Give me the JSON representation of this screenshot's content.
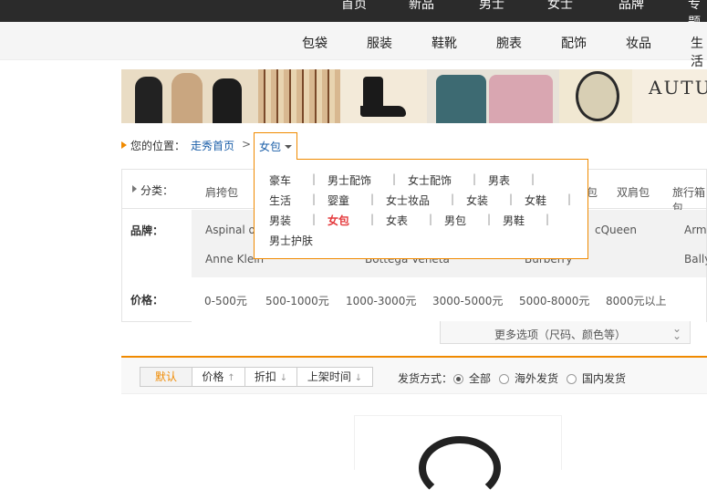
{
  "top_nav": [
    "首页",
    "新品",
    "男士",
    "女士",
    "品牌",
    "专题"
  ],
  "category_nav": [
    "包袋",
    "服装",
    "鞋靴",
    "腕表",
    "配饰",
    "妆品",
    "生活"
  ],
  "banner": {
    "text": "AUTUM"
  },
  "breadcrumb": {
    "label": "您的位置：",
    "home": "走秀首页",
    "separator": ">",
    "current": "女包"
  },
  "dropdown": {
    "items": [
      "豪车",
      "男士配饰",
      "女士配饰",
      "男表",
      "生活",
      "婴童",
      "女士妆品",
      "女装",
      "女鞋",
      "男装",
      "女包",
      "女表",
      "男包",
      "男鞋",
      "男士护肤"
    ],
    "active": "女包"
  },
  "filters": {
    "category_label": "分类：",
    "categories": [
      "肩挎包",
      "包",
      "双肩包",
      "旅行箱包"
    ],
    "brand_label": "品牌：",
    "brands": [
      "Aspinal of",
      "cQueen",
      "Arma",
      "Anne Klein",
      "Bottega Veneta",
      "Burberry",
      "Bally"
    ],
    "price_label": "价格：",
    "prices": [
      "0-500元",
      "500-1000元",
      "1000-3000元",
      "3000-5000元",
      "5000-8000元",
      "8000元以上"
    ],
    "more_options": "更多选项（尺码、颜色等）"
  },
  "sort": {
    "default": "默认",
    "price": "价格",
    "discount": "折扣",
    "new": "上架时间",
    "shipping_label": "发货方式：",
    "shipping_options": [
      "全部",
      "海外发货",
      "国内发货"
    ],
    "shipping_selected": "全部"
  },
  "colors": {
    "accent": "#f08a00",
    "link": "#1a5ea8",
    "active_red": "#e4393c"
  }
}
